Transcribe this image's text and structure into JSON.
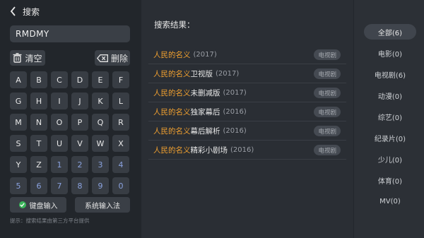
{
  "header": {
    "title": "搜索"
  },
  "search": {
    "query": "RMDMY"
  },
  "actions": {
    "clear": "清空",
    "delete": "删除"
  },
  "keyboard": {
    "keys": [
      "A",
      "B",
      "C",
      "D",
      "E",
      "F",
      "G",
      "H",
      "I",
      "J",
      "K",
      "L",
      "M",
      "N",
      "O",
      "P",
      "Q",
      "R",
      "S",
      "T",
      "U",
      "V",
      "W",
      "X",
      "Y",
      "Z",
      "1",
      "2",
      "3",
      "4",
      "5",
      "6",
      "7",
      "8",
      "9",
      "0"
    ]
  },
  "input_modes": {
    "keyboard": "键盘输入",
    "system": "系统输入法"
  },
  "hint": "提示：搜索结果由第三方平台提供",
  "results": {
    "title": "搜索结果：",
    "items": [
      {
        "highlight": "人民的名义",
        "rest": "",
        "year": "(2017)",
        "badge": "电视剧"
      },
      {
        "highlight": "人民的名义",
        "rest": "卫视版",
        "year": "(2017)",
        "badge": "电视剧"
      },
      {
        "highlight": "人民的名义",
        "rest": "未删减版",
        "year": "(2017)",
        "badge": "电视剧"
      },
      {
        "highlight": "人民的名义",
        "rest": "独家幕后",
        "year": "(2016)",
        "badge": "电视剧"
      },
      {
        "highlight": "人民的名义",
        "rest": "幕后解析",
        "year": "(2016)",
        "badge": "电视剧"
      },
      {
        "highlight": "人民的名义",
        "rest": "精彩小剧场",
        "year": "(2016)",
        "badge": "电视剧"
      }
    ]
  },
  "categories": [
    {
      "label": "全部(6)",
      "active": true
    },
    {
      "label": "电影(0)",
      "active": false
    },
    {
      "label": "电视剧(6)",
      "active": false
    },
    {
      "label": "动漫(0)",
      "active": false
    },
    {
      "label": "综艺(0)",
      "active": false
    },
    {
      "label": "纪录片(0)",
      "active": false
    },
    {
      "label": "少儿(0)",
      "active": false
    },
    {
      "label": "体育(0)",
      "active": false
    },
    {
      "label": "MV(0)",
      "active": false
    }
  ],
  "colors": {
    "highlight": "#f0a030",
    "number_keys": "#8aa2df",
    "check": "#3ab55a"
  }
}
